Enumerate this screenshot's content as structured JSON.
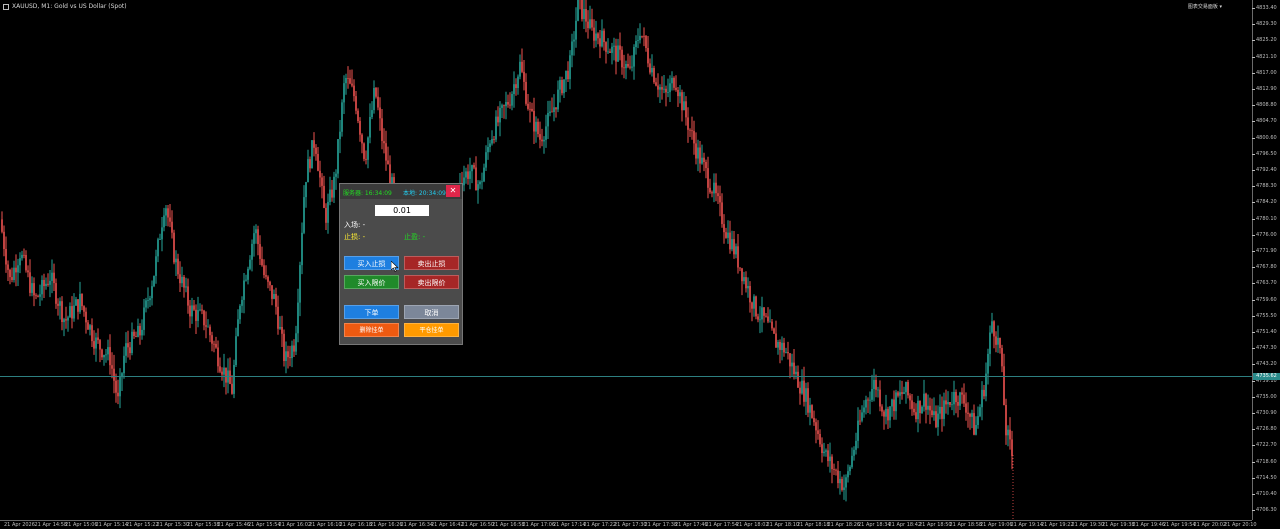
{
  "symbol": {
    "label": "XAUUSD, M1: Gold vs US Dollar (Spot)"
  },
  "top_right": {
    "label": "图表交易面板 ▾"
  },
  "price_axis": {
    "ticks": [
      "4833.40",
      "4829.30",
      "4825.20",
      "4821.10",
      "4817.00",
      "4812.90",
      "4808.80",
      "4804.70",
      "4800.60",
      "4796.50",
      "4792.40",
      "4788.30",
      "4784.20",
      "4780.10",
      "4776.00",
      "4771.90",
      "4767.80",
      "4763.70",
      "4759.60",
      "4755.50",
      "4751.40",
      "4747.30",
      "4743.20",
      "4739.10",
      "4735.00",
      "4730.90",
      "4726.80",
      "4722.70",
      "4718.60",
      "4714.50",
      "4710.40",
      "4706.30"
    ],
    "current_price": "4735.62"
  },
  "time_axis": {
    "ticks": [
      "21 Apr 2026",
      "21 Apr 14:58",
      "21 Apr 15:06",
      "21 Apr 15:14",
      "21 Apr 15:22",
      "21 Apr 15:30",
      "21 Apr 15:38",
      "21 Apr 15:46",
      "21 Apr 15:54",
      "21 Apr 16:02",
      "21 Apr 16:10",
      "21 Apr 16:18",
      "21 Apr 16:26",
      "21 Apr 16:34",
      "21 Apr 16:42",
      "21 Apr 16:50",
      "21 Apr 16:58",
      "21 Apr 17:06",
      "21 Apr 17:14",
      "21 Apr 17:22",
      "21 Apr 17:30",
      "21 Apr 17:38",
      "21 Apr 17:46",
      "21 Apr 17:54",
      "21 Apr 18:02",
      "21 Apr 18:10",
      "21 Apr 18:18",
      "21 Apr 18:26",
      "21 Apr 18:34",
      "21 Apr 18:42",
      "21 Apr 18:50",
      "21 Apr 18:58",
      "21 Apr 19:06",
      "21 Apr 19:14",
      "21 Apr 19:22",
      "21 Apr 19:30",
      "21 Apr 19:38",
      "21 Apr 19:46",
      "21 Apr 19:54",
      "21 Apr 20:02",
      "21 Apr 20:10"
    ]
  },
  "panel": {
    "server_time": "服务器: 16:34:09",
    "local_time": "本地: 20:34:09",
    "close_label": "✕",
    "lot_value": "0.01",
    "entry_label": "入场: -",
    "sl_label": "止损: -",
    "tp_label": "止盈: -",
    "buy_stop": "买入止损",
    "sell_stop": "卖出止损",
    "buy_limit": "买入限价",
    "sell_limit": "卖出限价",
    "place_order": "下单",
    "cancel": "取消",
    "delete_orders": "删除挂单",
    "close_orders": "平仓挂单"
  },
  "colors": {
    "bull": "#26a69a",
    "bear": "#ef5350",
    "background": "#000000",
    "price_line": "#2d7f80"
  },
  "chart_data": {
    "type": "candlestick",
    "path_points": [
      [
        0,
        4780
      ],
      [
        10,
        4765
      ],
      [
        20,
        4772
      ],
      [
        35,
        4760
      ],
      [
        50,
        4766
      ],
      [
        65,
        4755
      ],
      [
        80,
        4760
      ],
      [
        95,
        4750
      ],
      [
        110,
        4746
      ],
      [
        118,
        4735
      ],
      [
        125,
        4748
      ],
      [
        140,
        4752
      ],
      [
        155,
        4768
      ],
      [
        165,
        4785
      ],
      [
        175,
        4770
      ],
      [
        190,
        4758
      ],
      [
        205,
        4755
      ],
      [
        220,
        4745
      ],
      [
        232,
        4738
      ],
      [
        240,
        4760
      ],
      [
        255,
        4778
      ],
      [
        265,
        4765
      ],
      [
        275,
        4760
      ],
      [
        285,
        4745
      ],
      [
        295,
        4750
      ],
      [
        305,
        4790
      ],
      [
        315,
        4800
      ],
      [
        325,
        4780
      ],
      [
        335,
        4790
      ],
      [
        345,
        4815
      ],
      [
        355,
        4810
      ],
      [
        365,
        4795
      ],
      [
        375,
        4812
      ],
      [
        382,
        4800
      ],
      [
        390,
        4790
      ],
      [
        400,
        4780
      ],
      [
        410,
        4775
      ],
      [
        420,
        4772
      ],
      [
        430,
        4770
      ],
      [
        440,
        4765
      ],
      [
        450,
        4778
      ],
      [
        460,
        4790
      ],
      [
        470,
        4792
      ],
      [
        480,
        4788
      ],
      [
        490,
        4800
      ],
      [
        500,
        4805
      ],
      [
        510,
        4810
      ],
      [
        520,
        4818
      ],
      [
        530,
        4806
      ],
      [
        540,
        4800
      ],
      [
        550,
        4805
      ],
      [
        560,
        4812
      ],
      [
        570,
        4818
      ],
      [
        578,
        4833
      ],
      [
        585,
        4830
      ],
      [
        592,
        4826
      ],
      [
        600,
        4825
      ],
      [
        610,
        4822
      ],
      [
        620,
        4820
      ],
      [
        630,
        4816
      ],
      [
        640,
        4827
      ],
      [
        648,
        4820
      ],
      [
        655,
        4815
      ],
      [
        665,
        4810
      ],
      [
        675,
        4815
      ],
      [
        685,
        4806
      ],
      [
        695,
        4798
      ],
      [
        705,
        4792
      ],
      [
        715,
        4786
      ],
      [
        725,
        4778
      ],
      [
        735,
        4772
      ],
      [
        745,
        4765
      ],
      [
        755,
        4758
      ],
      [
        765,
        4755
      ],
      [
        775,
        4750
      ],
      [
        785,
        4748
      ],
      [
        795,
        4742
      ],
      [
        805,
        4737
      ],
      [
        815,
        4730
      ],
      [
        825,
        4722
      ],
      [
        835,
        4718
      ],
      [
        845,
        4714
      ],
      [
        855,
        4725
      ],
      [
        865,
        4735
      ],
      [
        875,
        4740
      ],
      [
        885,
        4732
      ],
      [
        895,
        4735
      ],
      [
        905,
        4738
      ],
      [
        915,
        4733
      ],
      [
        925,
        4736
      ],
      [
        935,
        4730
      ],
      [
        945,
        4734
      ],
      [
        955,
        4737
      ],
      [
        965,
        4735
      ],
      [
        975,
        4728
      ],
      [
        985,
        4740
      ],
      [
        992,
        4755
      ],
      [
        1000,
        4748
      ],
      [
        1006,
        4728
      ],
      [
        1012,
        4722
      ]
    ]
  }
}
